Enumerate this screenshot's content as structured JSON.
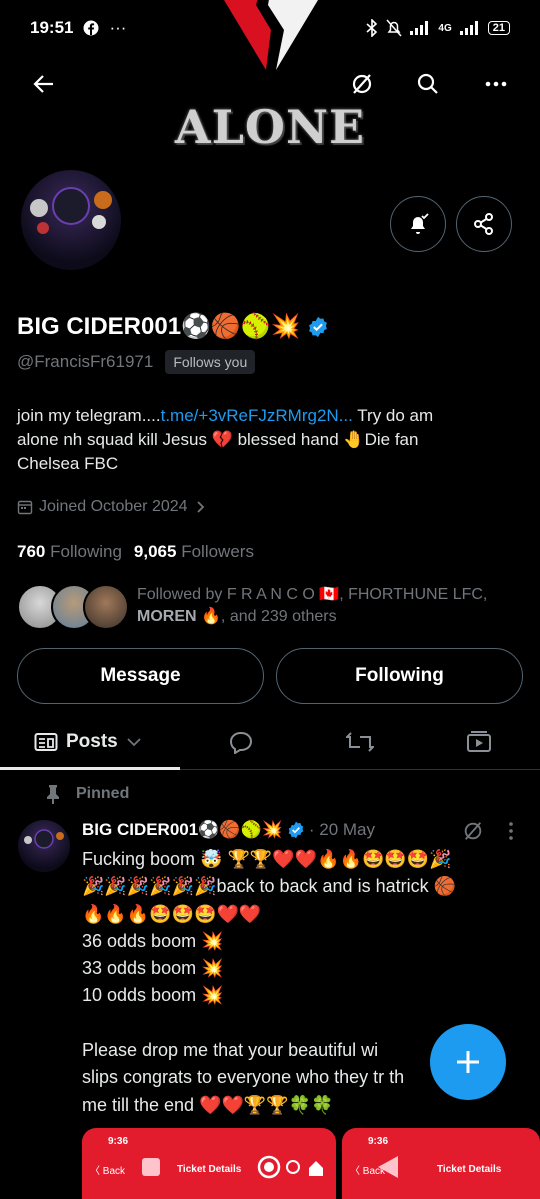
{
  "status_bar": {
    "time": "19:51",
    "left_extra": "···",
    "right_text": "4G",
    "battery": "21"
  },
  "banner": {
    "text": "ALONE"
  },
  "profile": {
    "name": "BIG CIDER001⚽🏀🥎💥",
    "handle": "@FrancisFr61971",
    "follows_you": "Follows you",
    "bio_prefix": "join my telegram....",
    "bio_link": "t.me/+3vReFJzRMrg2N...",
    "bio_line1_suffix": " Try do am",
    "bio_line2": "alone nh squad kill Jesus 💔 blessed hand 🤚Die fan",
    "bio_line3": "Chelsea FBC",
    "joined": "Joined October 2024",
    "following_count": "760",
    "following_label": "Following",
    "followers_count": "9,065",
    "followers_label": "Followers",
    "followed_by_prefix": "Followed by F R A N C O 🇨🇦, FHORTHUNE LFC,",
    "followed_by_bold": "MOREN 🔥",
    "followed_by_suffix": ", and 239 others"
  },
  "actions": {
    "message": "Message",
    "following": "Following"
  },
  "tabs": {
    "posts": "Posts"
  },
  "post": {
    "pinned": "Pinned",
    "author": "BIG CIDER001⚽🏀🥎💥",
    "date": "· 20 May",
    "lines": [
      "Fucking boom 🤯 🏆🏆❤️❤️🔥🔥🤩🤩🤩🎉",
      "🎉🎉🎉🎉🎉🎉back to back and is hatrick 🏀",
      "🔥🔥🔥🤩🤩🤩❤️❤️",
      "36 odds boom 💥",
      "33 odds boom 💥",
      "10 odds boom 💥",
      "",
      "Please drop me that your beautiful wi",
      "slips congrats to everyone who they tr           th",
      "me till the end ❤️❤️🏆🏆🍀🍀"
    ]
  },
  "thumbnails": [
    {
      "time": "9:36",
      "back": "〈 Back",
      "title": "Ticket Details"
    },
    {
      "time": "9:36",
      "back": "〈 Back",
      "title": "Ticket Details"
    }
  ],
  "colors": {
    "accent": "#1d9bf0",
    "muted": "#71767b",
    "border": "#536471",
    "thumb_red": "#e21b2d"
  }
}
